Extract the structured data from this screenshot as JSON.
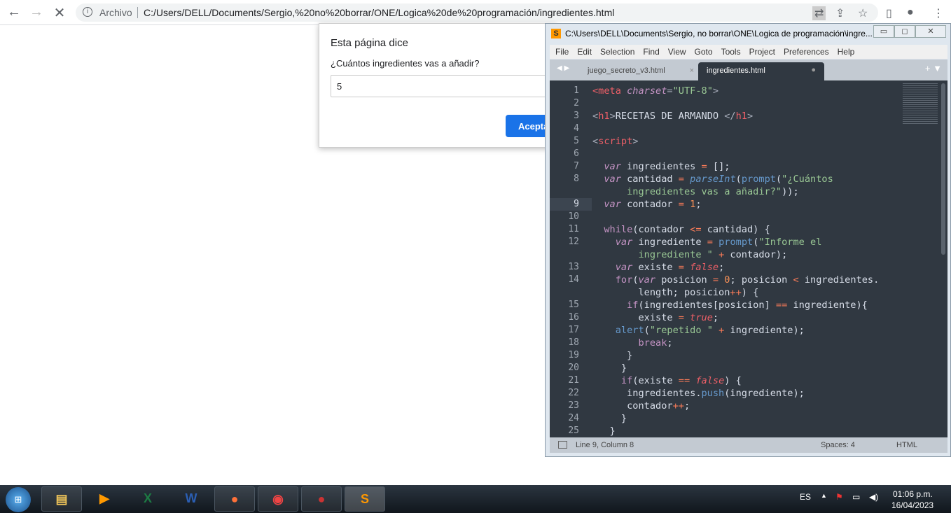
{
  "browser": {
    "archivo": "Archivo",
    "url": "C:/Users/DELL/Documents/Sergio,%20no%20borrar/ONE/Logica%20de%20programación/ingredientes.html"
  },
  "dialog": {
    "title": "Esta página dice",
    "message": "¿Cuántos ingredientes vas a añadir?",
    "input_value": "5",
    "ok_label": "Aceptar"
  },
  "editor": {
    "title": "C:\\Users\\DELL\\Documents\\Sergio, no borrar\\ONE\\Logica de programación\\ingre...",
    "menu": [
      "File",
      "Edit",
      "Selection",
      "Find",
      "View",
      "Goto",
      "Tools",
      "Project",
      "Preferences",
      "Help"
    ],
    "tabs": [
      {
        "label": "juego_secreto_v3.html",
        "active": false
      },
      {
        "label": "ingredientes.html",
        "active": true
      }
    ],
    "current_line": 9,
    "lines": [
      {
        "n": "1",
        "t": [
          [
            "tag",
            "<meta"
          ],
          [
            "pl",
            " "
          ],
          [
            "kw",
            "charset"
          ],
          [
            "pu",
            "="
          ],
          [
            "str",
            "\"UTF-8\""
          ],
          [
            "pu",
            ">"
          ]
        ]
      },
      {
        "n": "2",
        "t": []
      },
      {
        "n": "3",
        "t": [
          [
            "pu",
            "<"
          ],
          [
            "tag",
            "h1"
          ],
          [
            "pu",
            ">"
          ],
          [
            "pl",
            "RECETAS DE ARMANDO "
          ],
          [
            "pu",
            "</"
          ],
          [
            "tag",
            "h1"
          ],
          [
            "pu",
            ">"
          ]
        ]
      },
      {
        "n": "4",
        "t": []
      },
      {
        "n": "5",
        "t": [
          [
            "pu",
            "<"
          ],
          [
            "tag",
            "script"
          ],
          [
            "pu",
            ">"
          ]
        ]
      },
      {
        "n": "6",
        "t": []
      },
      {
        "n": "7",
        "t": [
          [
            "pl",
            "  "
          ],
          [
            "kw",
            "var"
          ],
          [
            "pl",
            " ingredientes "
          ],
          [
            "op",
            "="
          ],
          [
            "pl",
            " [];"
          ]
        ]
      },
      {
        "n": "8",
        "t": [
          [
            "pl",
            "  "
          ],
          [
            "kw",
            "var"
          ],
          [
            "pl",
            " cantidad "
          ],
          [
            "op",
            "="
          ],
          [
            "pl",
            " "
          ],
          [
            "fn",
            "parseInt"
          ],
          [
            "pl",
            "("
          ],
          [
            "bi",
            "prompt"
          ],
          [
            "pl",
            "("
          ],
          [
            "str",
            "\"¿Cuántos"
          ]
        ]
      },
      {
        "n": "",
        "t": [
          [
            "str",
            "      ingredientes vas a añadir?\""
          ],
          [
            "pl",
            "));"
          ]
        ]
      },
      {
        "n": "9",
        "t": [
          [
            "pl",
            "  "
          ],
          [
            "kw",
            "var"
          ],
          [
            "pl",
            " contador "
          ],
          [
            "op",
            "="
          ],
          [
            "pl",
            " "
          ],
          [
            "num",
            "1"
          ],
          [
            "pl",
            ";"
          ]
        ]
      },
      {
        "n": "10",
        "t": []
      },
      {
        "n": "11",
        "t": [
          [
            "pl",
            "  "
          ],
          [
            "ctl",
            "while"
          ],
          [
            "pl",
            "(contador "
          ],
          [
            "op",
            "<="
          ],
          [
            "pl",
            " cantidad) {"
          ]
        ]
      },
      {
        "n": "12",
        "t": [
          [
            "pl",
            "    "
          ],
          [
            "kw",
            "var"
          ],
          [
            "pl",
            " ingrediente "
          ],
          [
            "op",
            "="
          ],
          [
            "pl",
            " "
          ],
          [
            "bi",
            "prompt"
          ],
          [
            "pl",
            "("
          ],
          [
            "str",
            "\"Informe el"
          ]
        ]
      },
      {
        "n": "",
        "t": [
          [
            "str",
            "        ingrediente \""
          ],
          [
            "pl",
            " "
          ],
          [
            "op",
            "+"
          ],
          [
            "pl",
            " contador);"
          ]
        ]
      },
      {
        "n": "13",
        "t": [
          [
            "pl",
            "    "
          ],
          [
            "kw",
            "var"
          ],
          [
            "pl",
            " existe "
          ],
          [
            "op",
            "="
          ],
          [
            "pl",
            " "
          ],
          [
            "bool",
            "false"
          ],
          [
            "pl",
            ";"
          ]
        ]
      },
      {
        "n": "14",
        "t": [
          [
            "pl",
            "    "
          ],
          [
            "ctl",
            "for"
          ],
          [
            "pl",
            "("
          ],
          [
            "kw",
            "var"
          ],
          [
            "pl",
            " posicion "
          ],
          [
            "op",
            "="
          ],
          [
            "pl",
            " "
          ],
          [
            "num",
            "0"
          ],
          [
            "pl",
            "; posicion "
          ],
          [
            "op",
            "<"
          ],
          [
            "pl",
            " ingredientes."
          ]
        ]
      },
      {
        "n": "",
        "t": [
          [
            "pl",
            "        length; posicion"
          ],
          [
            "op",
            "++"
          ],
          [
            "pl",
            ") {"
          ]
        ]
      },
      {
        "n": "15",
        "t": [
          [
            "pl",
            "      "
          ],
          [
            "ctl",
            "if"
          ],
          [
            "pl",
            "(ingredientes[posicion] "
          ],
          [
            "op",
            "=="
          ],
          [
            "pl",
            " ingrediente){"
          ]
        ]
      },
      {
        "n": "16",
        "t": [
          [
            "pl",
            "        existe "
          ],
          [
            "op",
            "="
          ],
          [
            "pl",
            " "
          ],
          [
            "bool",
            "true"
          ],
          [
            "pl",
            ";"
          ]
        ]
      },
      {
        "n": "17",
        "t": [
          [
            "pl",
            "    "
          ],
          [
            "bi",
            "alert"
          ],
          [
            "pl",
            "("
          ],
          [
            "str",
            "\"repetido \""
          ],
          [
            "pl",
            " "
          ],
          [
            "op",
            "+"
          ],
          [
            "pl",
            " ingrediente);"
          ]
        ]
      },
      {
        "n": "18",
        "t": [
          [
            "pl",
            "        "
          ],
          [
            "ctl",
            "break"
          ],
          [
            "pl",
            ";"
          ]
        ]
      },
      {
        "n": "19",
        "t": [
          [
            "pl",
            "      }"
          ]
        ]
      },
      {
        "n": "20",
        "t": [
          [
            "pl",
            "     }"
          ]
        ]
      },
      {
        "n": "21",
        "t": [
          [
            "pl",
            "     "
          ],
          [
            "ctl",
            "if"
          ],
          [
            "pl",
            "(existe "
          ],
          [
            "op",
            "=="
          ],
          [
            "pl",
            " "
          ],
          [
            "bool",
            "false"
          ],
          [
            "pl",
            ") {"
          ]
        ]
      },
      {
        "n": "22",
        "t": [
          [
            "pl",
            "      ingredientes."
          ],
          [
            "bi",
            "push"
          ],
          [
            "pl",
            "(ingrediente);"
          ]
        ]
      },
      {
        "n": "23",
        "t": [
          [
            "pl",
            "      contador"
          ],
          [
            "op",
            "++"
          ],
          [
            "pl",
            ";"
          ]
        ]
      },
      {
        "n": "24",
        "t": [
          [
            "pl",
            "     }"
          ]
        ]
      },
      {
        "n": "25",
        "t": [
          [
            "pl",
            "   }"
          ]
        ]
      }
    ],
    "status": {
      "position": "Line 9, Column 8",
      "spaces": "Spaces: 4",
      "syntax": "HTML"
    }
  },
  "taskbar": {
    "language": "ES",
    "time": "01:06 p.m.",
    "date": "16/04/2023",
    "apps": [
      "explorer",
      "media-player",
      "excel",
      "word",
      "firefox",
      "chrome",
      "app",
      "sublime-text"
    ]
  }
}
